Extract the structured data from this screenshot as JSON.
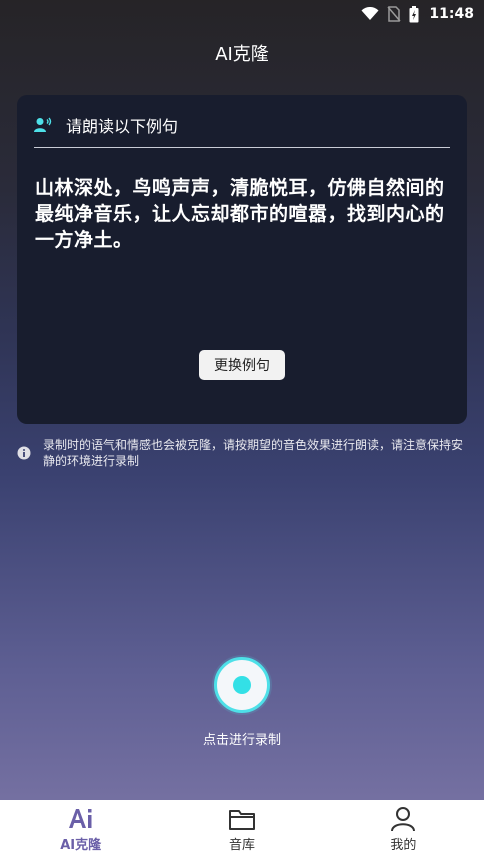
{
  "status_bar": {
    "time": "11:48"
  },
  "header": {
    "title": "AI克隆"
  },
  "card": {
    "heading": "请朗读以下例句",
    "sample_text": "山林深处，鸟鸣声声，清脆悦耳，仿佛自然间的最纯净音乐，让人忘却都市的喧嚣，找到内心的一方净土。",
    "change_button": "更换例句"
  },
  "tip": {
    "text": "录制时的语气和情感也会被克隆，请按期望的音色效果进行朗读，请注意保持安静的环境进行录制"
  },
  "record": {
    "label": "点击进行录制"
  },
  "tabs": [
    {
      "label": "AI克隆",
      "icon": "ai-icon",
      "active": true
    },
    {
      "label": "音库",
      "icon": "folder-icon",
      "active": false
    },
    {
      "label": "我的",
      "icon": "person-icon",
      "active": false
    }
  ],
  "colors": {
    "accent": "#4ee0e8",
    "tab_active": "#6a5fa8",
    "card_bg": "#181d2e"
  }
}
